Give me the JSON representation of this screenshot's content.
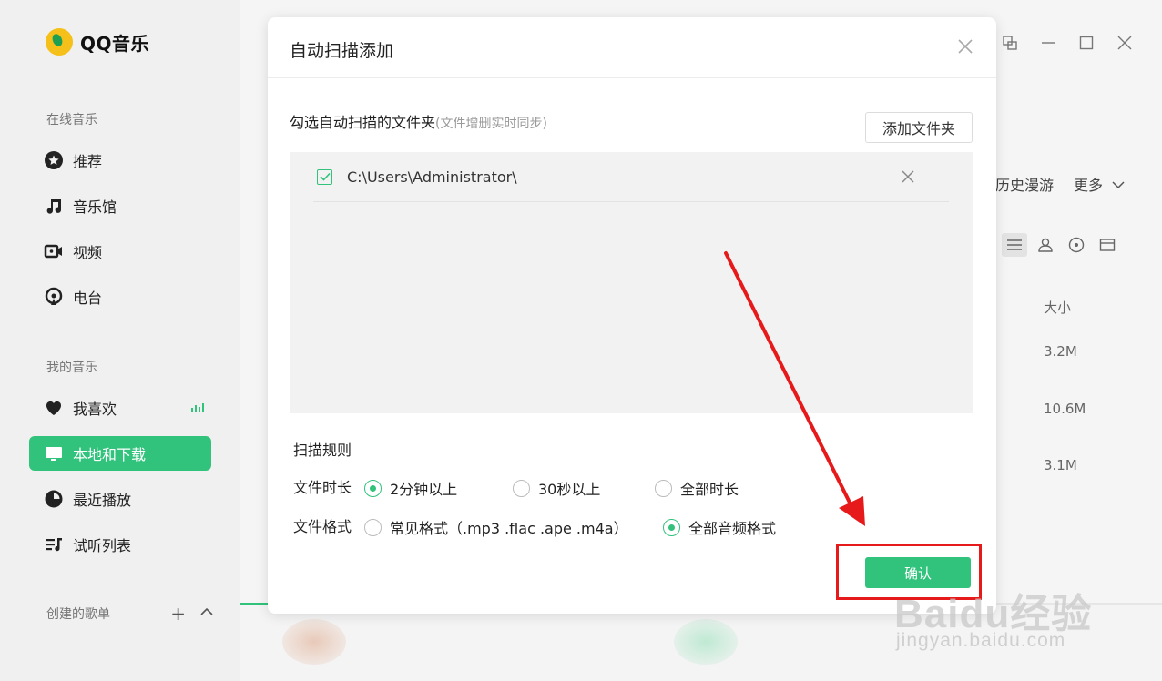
{
  "app": {
    "name": "QQ音乐"
  },
  "sidebar": {
    "online_title": "在线音乐",
    "online_items": [
      {
        "label": "推荐",
        "icon": "star-icon"
      },
      {
        "label": "音乐馆",
        "icon": "music-note-icon"
      },
      {
        "label": "视频",
        "icon": "video-icon"
      },
      {
        "label": "电台",
        "icon": "radio-icon"
      }
    ],
    "mine_title": "我的音乐",
    "mine_items": [
      {
        "label": "我喜欢",
        "icon": "heart-icon"
      },
      {
        "label": "本地和下载",
        "icon": "monitor-icon",
        "active": true
      },
      {
        "label": "最近播放",
        "icon": "clock-icon"
      },
      {
        "label": "试听列表",
        "icon": "playlist-icon"
      }
    ],
    "created_title": "创建的歌单"
  },
  "background": {
    "tabs": [
      "历史漫游",
      "更多"
    ],
    "size_header": "大小",
    "sizes": [
      "3.2M",
      "10.6M",
      "3.1M"
    ]
  },
  "dialog": {
    "title": "自动扫描添加",
    "folder_label": "勾选自动扫描的文件夹",
    "folder_hint": "(文件增删实时同步)",
    "add_folder_label": "添加文件夹",
    "folders": [
      {
        "path": "C:\\Users\\Administrator\\",
        "checked": true
      }
    ],
    "rules_title": "扫描规则",
    "duration": {
      "label": "文件时长",
      "options": [
        "2分钟以上",
        "30秒以上",
        "全部时长"
      ],
      "selected": "2分钟以上"
    },
    "format": {
      "label": "文件格式",
      "options": [
        "常见格式（.mp3 .flac .ape .m4a）",
        "全部音频格式"
      ],
      "selected": "全部音频格式"
    },
    "confirm_label": "确认"
  },
  "watermark": {
    "logo": "Baidu经验",
    "url": "jingyan.baidu.com"
  },
  "colors": {
    "accent": "#31c27c",
    "highlight": "#e61a1a"
  }
}
